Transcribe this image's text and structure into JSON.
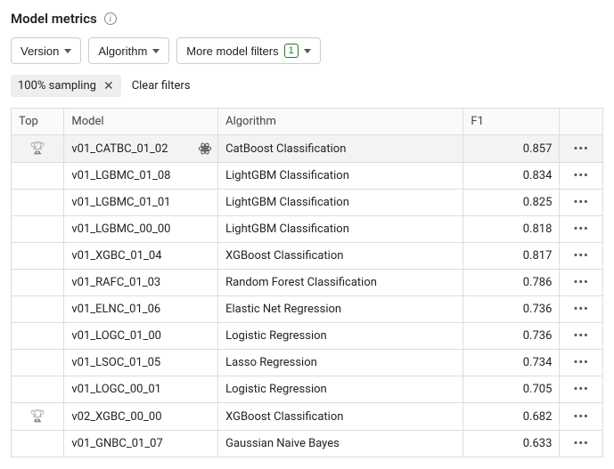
{
  "header": {
    "title": "Model metrics"
  },
  "filters": {
    "version_label": "Version",
    "algorithm_label": "Algorithm",
    "more_label": "More model filters",
    "more_badge": "1"
  },
  "chips": {
    "sampling_label": "100% sampling",
    "clear_label": "Clear filters"
  },
  "table": {
    "columns": {
      "top": "Top",
      "model": "Model",
      "algorithm": "Algorithm",
      "f1": "F1"
    },
    "rows": [
      {
        "top": true,
        "model": "v01_CATBC_01_02",
        "algorithm": "CatBoost Classification",
        "f1": "0.857",
        "selected": true,
        "atom": true
      },
      {
        "top": false,
        "model": "v01_LGBMC_01_08",
        "algorithm": "LightGBM Classification",
        "f1": "0.834",
        "selected": false,
        "atom": false
      },
      {
        "top": false,
        "model": "v01_LGBMC_01_01",
        "algorithm": "LightGBM Classification",
        "f1": "0.825",
        "selected": false,
        "atom": false
      },
      {
        "top": false,
        "model": "v01_LGBMC_00_00",
        "algorithm": "LightGBM Classification",
        "f1": "0.818",
        "selected": false,
        "atom": false
      },
      {
        "top": false,
        "model": "v01_XGBC_01_04",
        "algorithm": "XGBoost Classification",
        "f1": "0.817",
        "selected": false,
        "atom": false
      },
      {
        "top": false,
        "model": "v01_RAFC_01_03",
        "algorithm": "Random Forest Classification",
        "f1": "0.786",
        "selected": false,
        "atom": false
      },
      {
        "top": false,
        "model": "v01_ELNC_01_06",
        "algorithm": "Elastic Net Regression",
        "f1": "0.736",
        "selected": false,
        "atom": false
      },
      {
        "top": false,
        "model": "v01_LOGC_01_00",
        "algorithm": "Logistic Regression",
        "f1": "0.736",
        "selected": false,
        "atom": false
      },
      {
        "top": false,
        "model": "v01_LSOC_01_05",
        "algorithm": "Lasso Regression",
        "f1": "0.734",
        "selected": false,
        "atom": false
      },
      {
        "top": false,
        "model": "v01_LOGC_00_01",
        "algorithm": "Logistic Regression",
        "f1": "0.705",
        "selected": false,
        "atom": false
      },
      {
        "top": true,
        "model": "v02_XGBC_00_00",
        "algorithm": "XGBoost Classification",
        "f1": "0.682",
        "selected": false,
        "atom": false
      },
      {
        "top": false,
        "model": "v01_GNBC_01_07",
        "algorithm": "Gaussian Naive Bayes",
        "f1": "0.633",
        "selected": false,
        "atom": false
      }
    ]
  }
}
